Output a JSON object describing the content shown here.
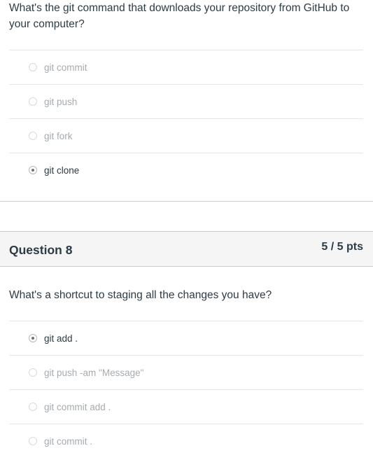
{
  "question7": {
    "text": "What's the git command that downloads your repository from GitHub to your computer?",
    "answers": [
      {
        "label": "git commit",
        "selected": false
      },
      {
        "label": "git push",
        "selected": false
      },
      {
        "label": "git fork",
        "selected": false
      },
      {
        "label": "git clone",
        "selected": true
      }
    ]
  },
  "question8": {
    "title": "Question 8",
    "points": "5 / 5 pts",
    "text": "What's a shortcut to staging all the changes you have?",
    "answers": [
      {
        "label": "git add .",
        "selected": true
      },
      {
        "label": "git push -am \"Message\"",
        "selected": false
      },
      {
        "label": "git commit add .",
        "selected": false
      },
      {
        "label": "git commit .",
        "selected": false
      }
    ]
  },
  "colors": {
    "text": "#2d3b45",
    "muted_text": "#a6abaf",
    "header_bg": "#f5f5f5",
    "divider": "#c7cdd1"
  }
}
